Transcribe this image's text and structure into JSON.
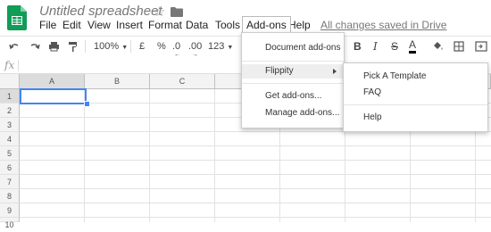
{
  "header": {
    "doc_title": "Untitled spreadsheet",
    "icons": [
      "sheets-logo-icon",
      "star-icon",
      "folder-icon"
    ]
  },
  "menubar": {
    "items": [
      "File",
      "Edit",
      "View",
      "Insert",
      "Format",
      "Data",
      "Tools",
      "Add-ons",
      "Help"
    ],
    "active": "Add-ons",
    "save_status": "All changes saved in Drive"
  },
  "toolbar": {
    "zoom": "100%",
    "currency": "£",
    "percent": "%",
    "dec_decrease": ".0",
    "dec_increase": ".00",
    "more_formats": "123",
    "bold": "B",
    "italic": "I",
    "strike": "S",
    "text_color": "A"
  },
  "formula_bar": {
    "fx": "fx",
    "value": ""
  },
  "grid": {
    "columns": [
      "A",
      "B",
      "C",
      "",
      "",
      "",
      "",
      ""
    ],
    "rows": [
      "1",
      "2",
      "3",
      "4",
      "5",
      "6",
      "7",
      "8",
      "9",
      "10"
    ],
    "selected_cell": "A1"
  },
  "addons_menu": {
    "items": [
      {
        "label": "Document add-ons"
      },
      {
        "label": "Flippity",
        "has_submenu": true,
        "highlighted": true
      },
      {
        "label": "Get add-ons..."
      },
      {
        "label": "Manage add-ons..."
      }
    ]
  },
  "flippity_submenu": {
    "items": [
      "Pick A Template",
      "FAQ",
      "Help"
    ]
  },
  "colors": {
    "sheets_green": "#0f9d58",
    "selection_blue": "#4285f4",
    "header_bg": "#f3f3f3"
  }
}
